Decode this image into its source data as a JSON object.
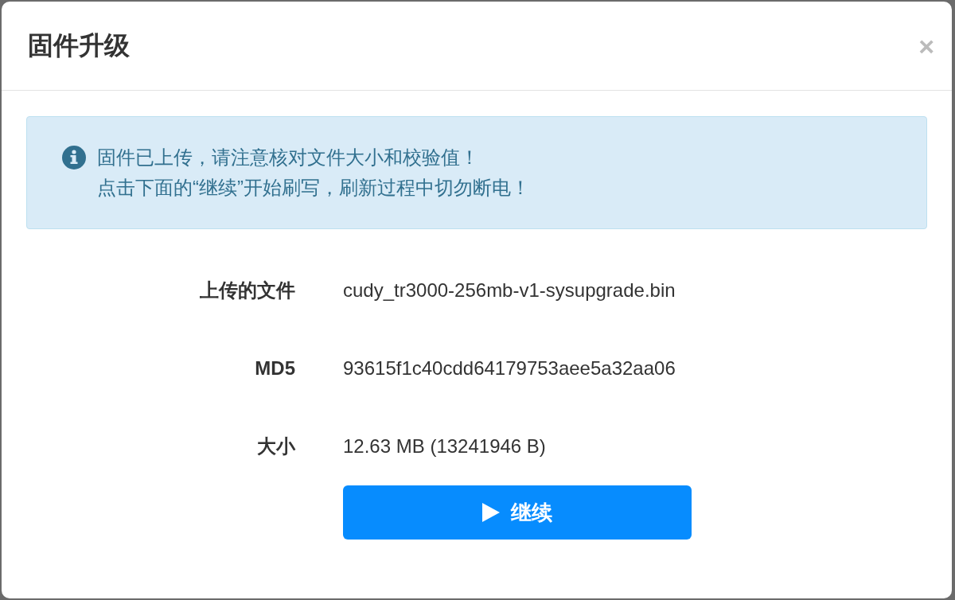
{
  "dialog": {
    "title": "固件升级",
    "close": "×"
  },
  "alert": {
    "lines": [
      "固件已上传，请注意核对文件大小和校验值！",
      "点击下面的“继续”开始刷写，刷新过程中切勿断电！"
    ]
  },
  "fields": [
    {
      "label": "上传的文件",
      "value": "cudy_tr3000-256mb-v1-sysupgrade.bin"
    },
    {
      "label": "MD5",
      "value": "93615f1c40cdd64179753aee5a32aa06"
    },
    {
      "label": "大小",
      "value": "12.63 MB (13241946 B)"
    }
  ],
  "button": {
    "label": "继续"
  }
}
